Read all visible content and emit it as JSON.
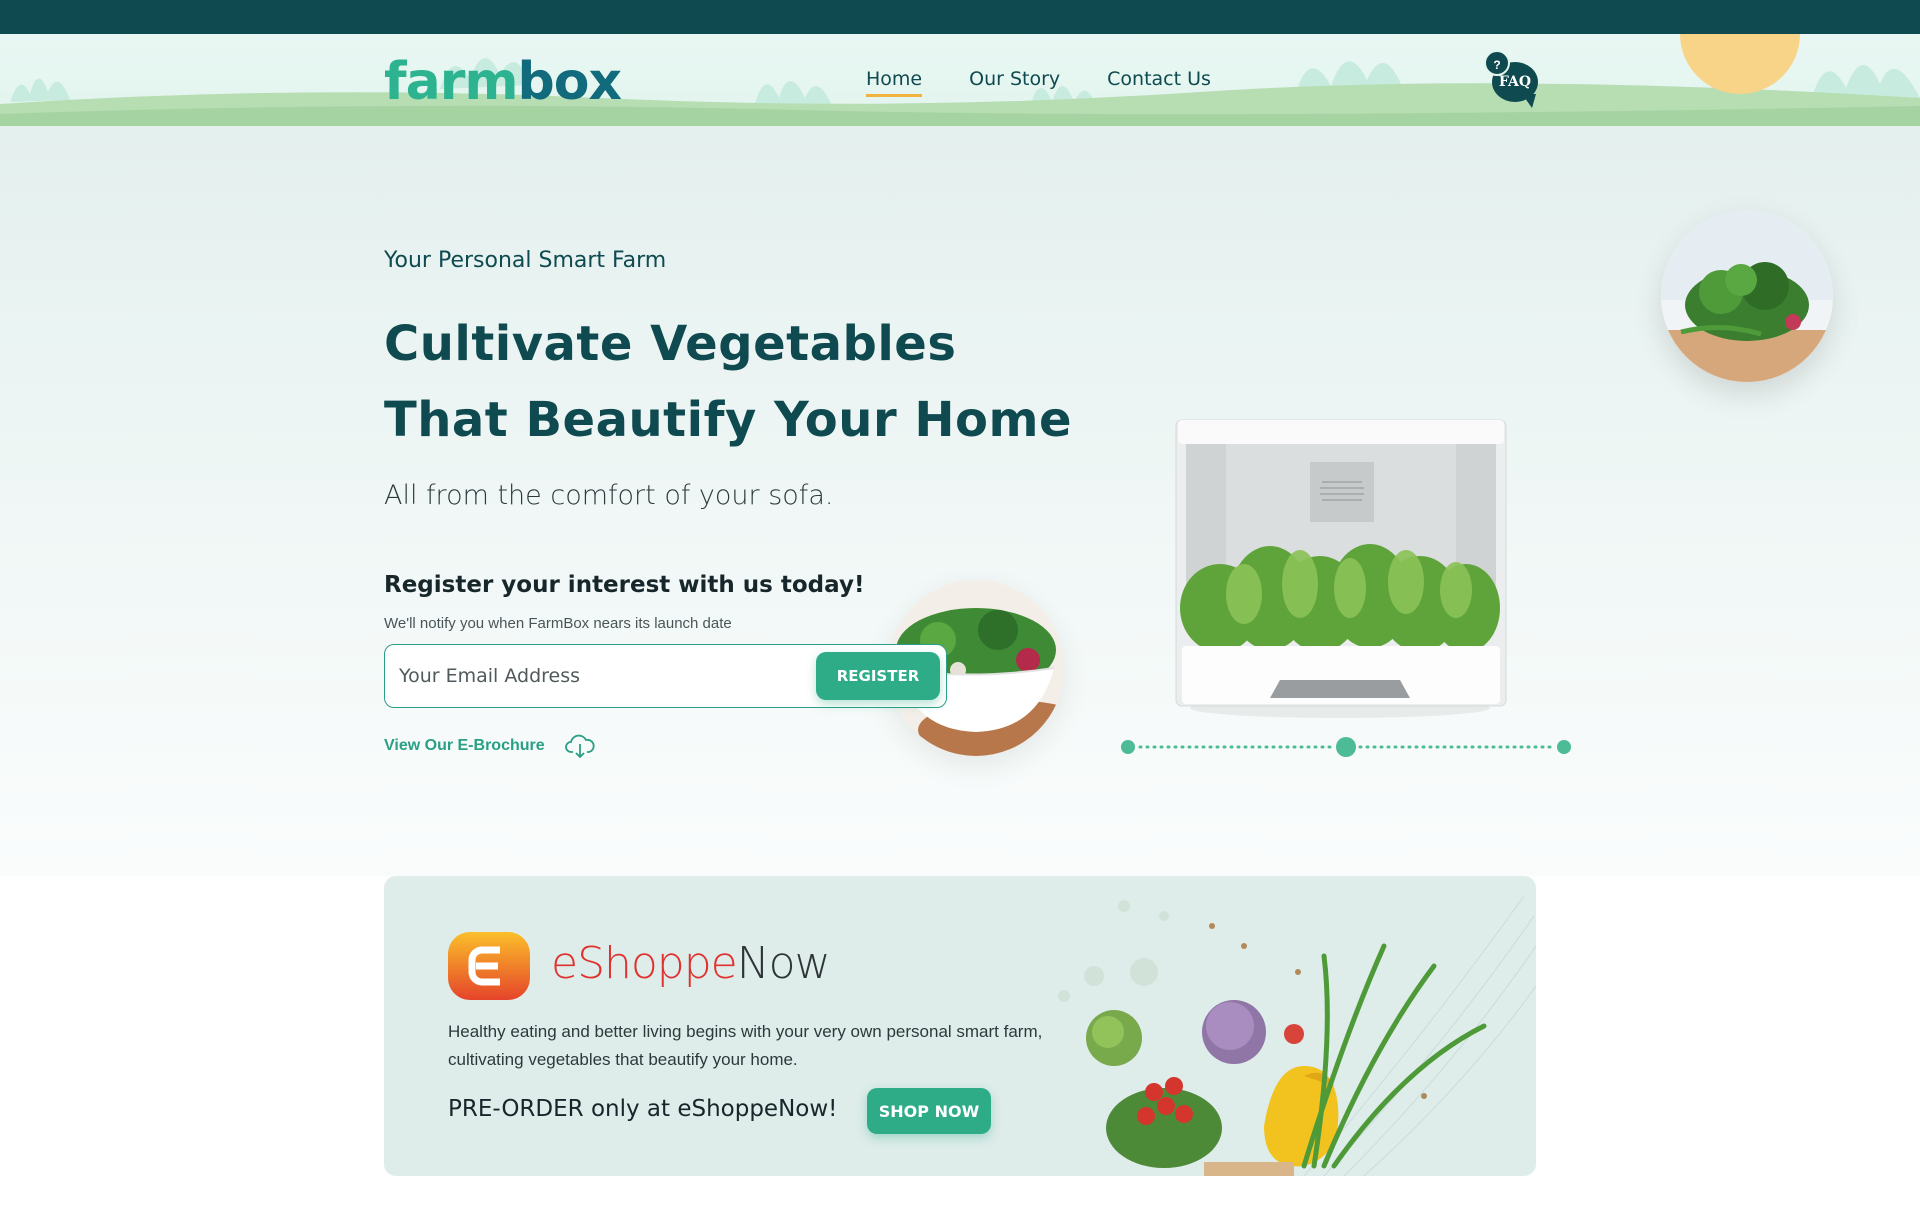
{
  "header": {
    "logo_part1": "farm",
    "logo_part2": "box",
    "nav": [
      {
        "label": "Home",
        "active": true
      },
      {
        "label": "Our Story",
        "active": false
      },
      {
        "label": "Contact Us",
        "active": false
      }
    ],
    "faq_question_mark": "?",
    "faq_label": "FAQ"
  },
  "hero": {
    "eyebrow": "Your Personal Smart Farm",
    "headline_line1": "Cultivate Vegetables",
    "headline_line2": "That Beautify Your Home",
    "subheadline": "All from the comfort of your sofa.",
    "register_title": "Register your interest with us today!",
    "register_note": "We'll notify you when FarmBox nears its launch date",
    "email_placeholder": "Your Email Address",
    "email_value": "",
    "register_button": "REGISTER",
    "brochure_link": "View Our E-Brochure",
    "carousel": {
      "slides": 3,
      "active_index": 1
    }
  },
  "banner": {
    "brand_part1": "eShoppe",
    "brand_part2": "Now",
    "description": "Healthy eating and better living begins with your very own personal smart farm, cultivating vegetables that beautify your home.",
    "preorder_text": "PRE-ORDER only at eShoppeNow!",
    "shop_button": "SHOP NOW"
  },
  "colors": {
    "primary_dark": "#0e4a4f",
    "accent_green": "#2eac88",
    "nav_underline": "#f0b33d",
    "brand_red": "#e0312e"
  },
  "icons": [
    "faq-bubble-icon",
    "cloud-download-icon",
    "eshoppenow-logo-icon"
  ]
}
